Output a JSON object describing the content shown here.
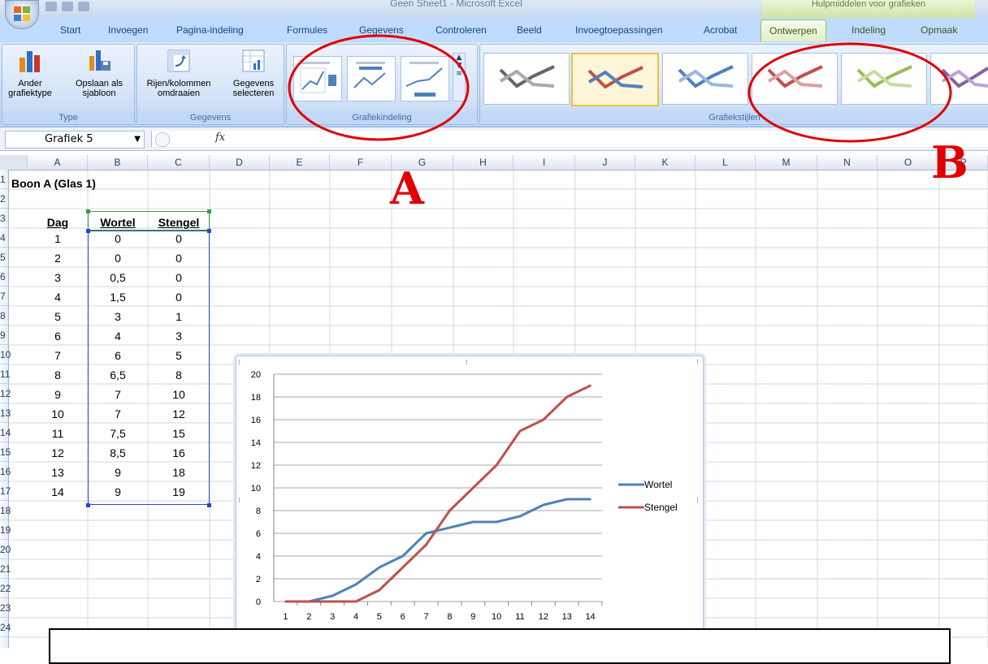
{
  "window": {
    "title": "Geen Sheet1 - Microsoft Excel",
    "context_title": "Hulpmiddelen voor grafieken"
  },
  "tabs": [
    {
      "label": "Start"
    },
    {
      "label": "Invoegen"
    },
    {
      "label": "Pagina-indeling"
    },
    {
      "label": "Formules"
    },
    {
      "label": "Gegevens"
    },
    {
      "label": "Controleren"
    },
    {
      "label": "Beeld"
    },
    {
      "label": "Invoegtoepassingen"
    },
    {
      "label": "Acrobat"
    },
    {
      "label": "Ontwerpen"
    },
    {
      "label": "Indeling"
    },
    {
      "label": "Opmaak"
    }
  ],
  "ribbon": {
    "type_group": {
      "label": "Type",
      "change_type_l1": "Ander",
      "change_type_l2": "grafiektype",
      "save_template_l1": "Opslaan als",
      "save_template_l2": "sjabloon"
    },
    "data_group": {
      "label": "Gegevens",
      "switch_l1": "Rijen/kolommen",
      "switch_l2": "omdraaien",
      "select_l1": "Gegevens",
      "select_l2": "selecteren"
    },
    "layout_group": {
      "label": "Grafiekindeling"
    },
    "styles_group": {
      "label": "Grafiekstijlen"
    },
    "style_colors": [
      "#666666",
      "#c0504d",
      "#4f81bd",
      "#c98a88",
      "#9bbb59",
      "#8064a2"
    ]
  },
  "formula_bar": {
    "name_box": "Grafiek 5",
    "fx": "fx",
    "content": ""
  },
  "columns": [
    "A",
    "B",
    "C",
    "D",
    "E",
    "F",
    "G",
    "H",
    "I",
    "J",
    "K",
    "L",
    "M",
    "N",
    "O",
    "P"
  ],
  "rows": [
    "1",
    "2",
    "3",
    "4",
    "5",
    "6",
    "7",
    "8",
    "9",
    "10",
    "11",
    "12",
    "13",
    "14",
    "15",
    "16",
    "17",
    "18",
    "19",
    "20",
    "21",
    "22",
    "23",
    "24"
  ],
  "sheet": {
    "title": "Boon A (Glas 1)",
    "headers": [
      "Dag",
      "Wortel",
      "Stengel"
    ],
    "data": [
      [
        "1",
        "0",
        "0"
      ],
      [
        "2",
        "0",
        "0"
      ],
      [
        "3",
        "0,5",
        "0"
      ],
      [
        "4",
        "1,5",
        "0"
      ],
      [
        "5",
        "3",
        "1"
      ],
      [
        "6",
        "4",
        "3"
      ],
      [
        "7",
        "6",
        "5"
      ],
      [
        "8",
        "6,5",
        "8"
      ],
      [
        "9",
        "7",
        "10"
      ],
      [
        "10",
        "7",
        "12"
      ],
      [
        "11",
        "7,5",
        "15"
      ],
      [
        "12",
        "8,5",
        "16"
      ],
      [
        "13",
        "9",
        "18"
      ],
      [
        "14",
        "9",
        "19"
      ]
    ]
  },
  "chart_data": {
    "type": "line",
    "title": "",
    "xlabel": "",
    "ylabel": "",
    "x": [
      1,
      2,
      3,
      4,
      5,
      6,
      7,
      8,
      9,
      10,
      11,
      12,
      13,
      14
    ],
    "ylim": [
      0,
      20
    ],
    "yticks": [
      0,
      2,
      4,
      6,
      8,
      10,
      12,
      14,
      16,
      18,
      20
    ],
    "grid": true,
    "legend": "right",
    "series": [
      {
        "name": "Wortel",
        "color": "#4f81bd",
        "values": [
          0,
          0,
          0.5,
          1.5,
          3,
          4,
          6,
          6.5,
          7,
          7,
          7.5,
          8.5,
          9,
          9
        ]
      },
      {
        "name": "Stengel",
        "color": "#c0504d",
        "values": [
          0,
          0,
          0,
          0,
          1,
          3,
          5,
          8,
          10,
          12,
          15,
          16,
          18,
          19
        ]
      }
    ]
  },
  "annotations": {
    "a": "A",
    "b": "B",
    "color": "#e00000"
  }
}
